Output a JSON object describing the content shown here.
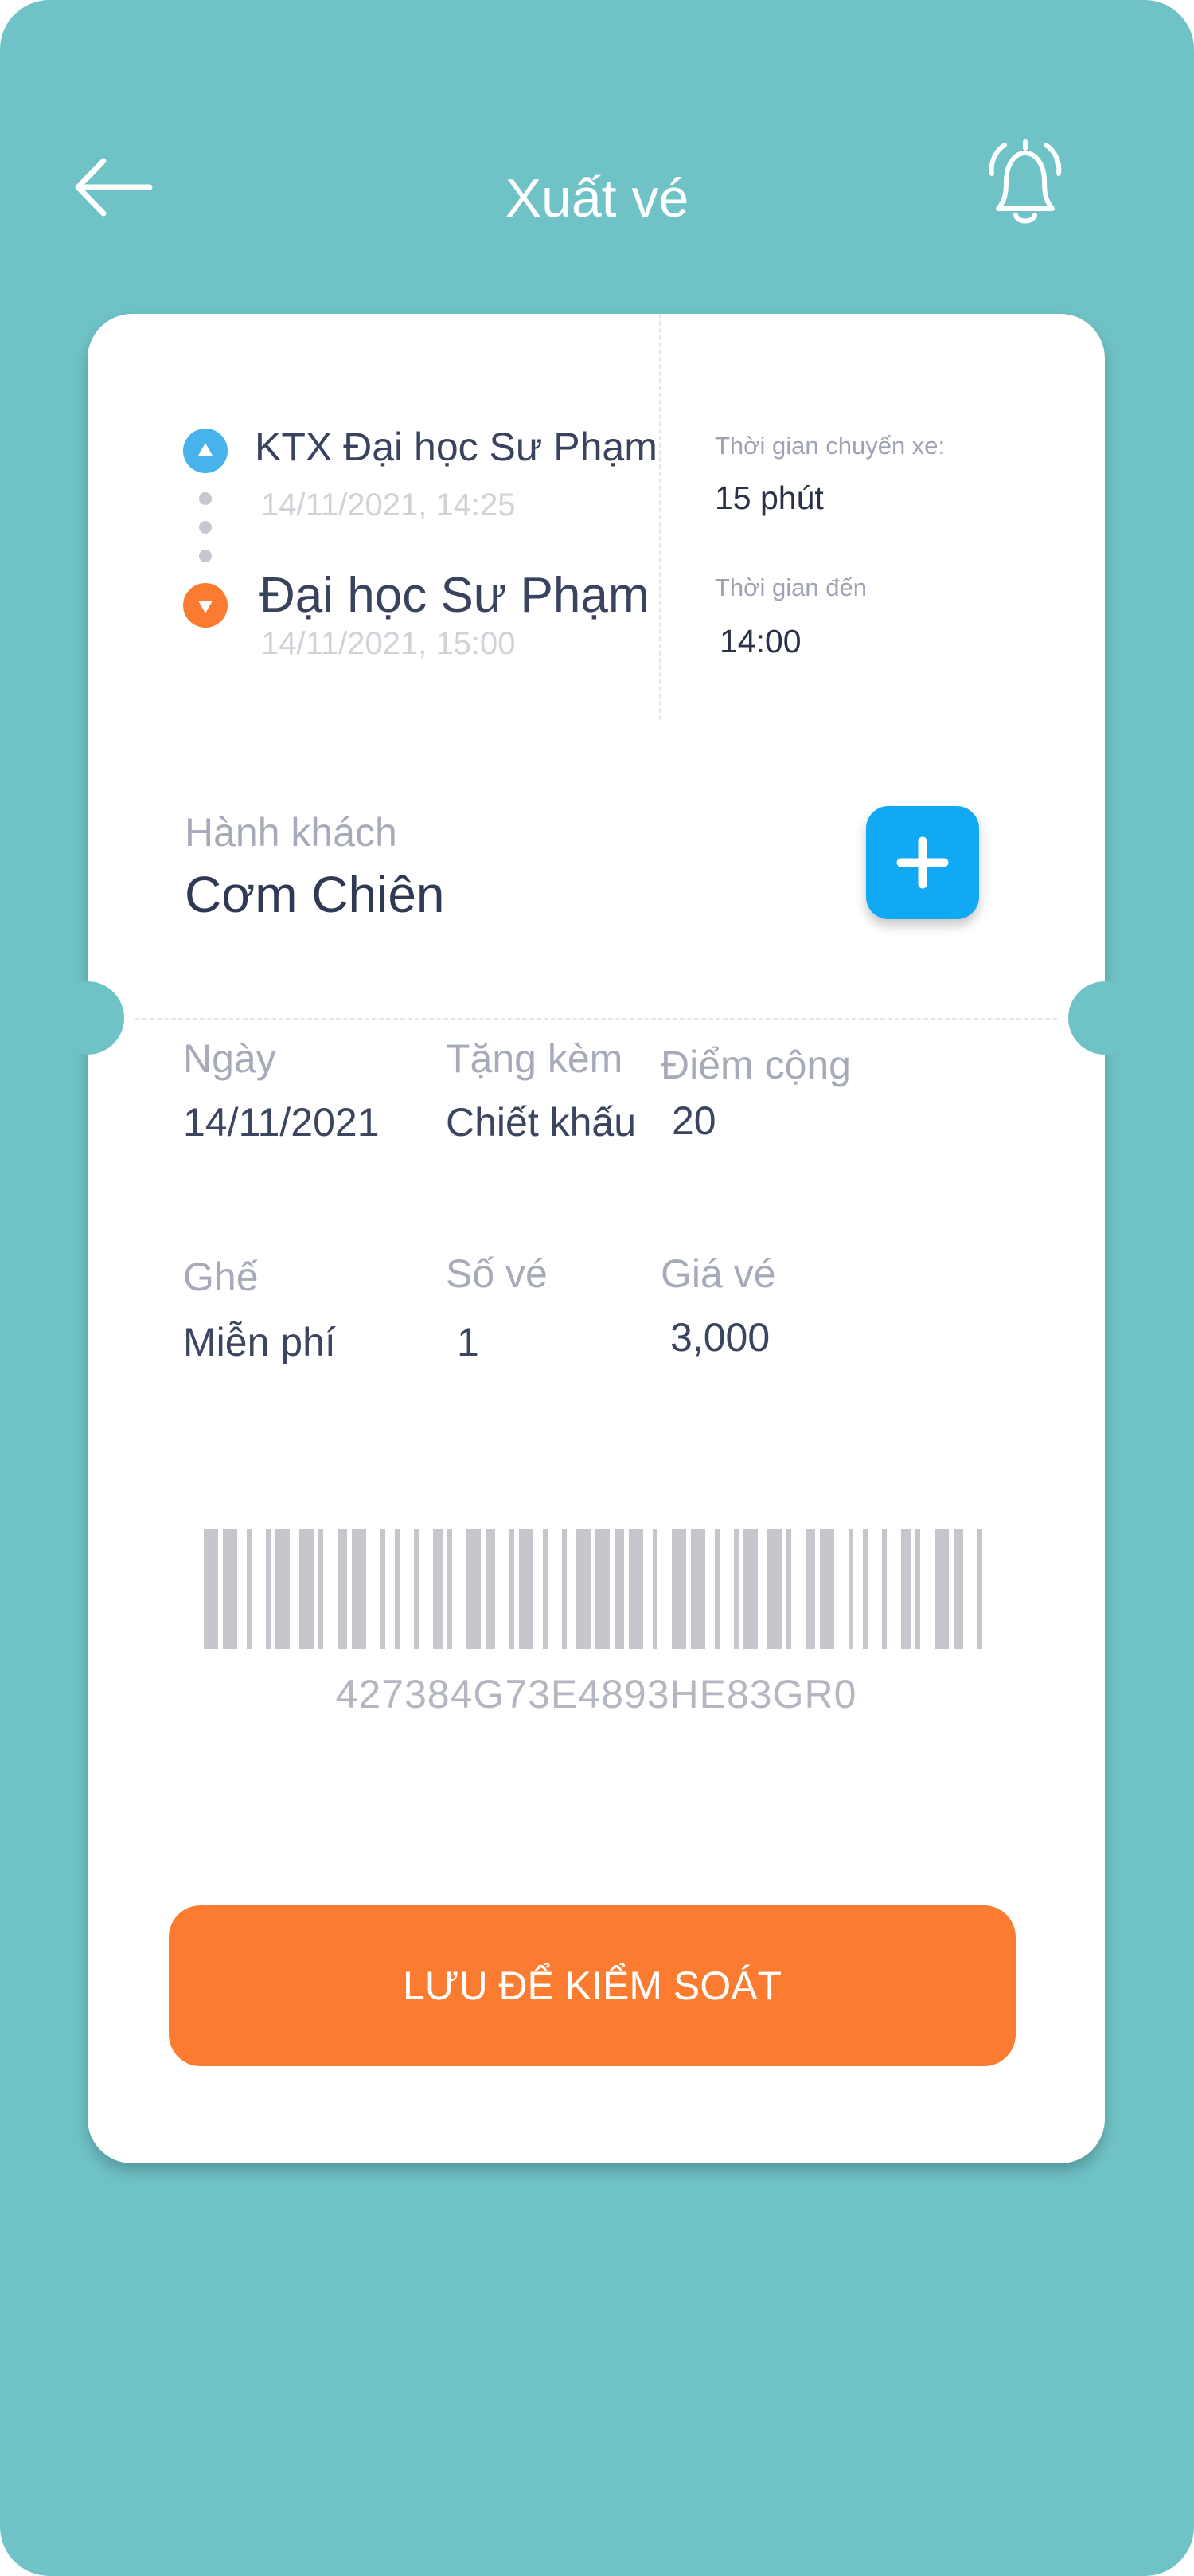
{
  "header": {
    "title": "Xuất vé",
    "back_icon": "arrow-left-icon",
    "bell_icon": "bell-ringing-icon"
  },
  "route": {
    "origin": {
      "name": "KTX Đại học Sư Phạm",
      "time": "14/11/2021, 14:25",
      "marker_color": "#47b3ec"
    },
    "destination": {
      "name": "Đại học Sư Phạm",
      "time": "14/11/2021, 15:00",
      "marker_color": "#fb7c30"
    },
    "transfer_label": "Thời gian chuyến xe:",
    "transfer_value": "15 phút",
    "arrival_label": "Thời gian đến",
    "arrival_value": "14:00"
  },
  "passenger": {
    "label": "Hành khách",
    "name": "Cơm Chiên",
    "add_icon": "plus-icon"
  },
  "details": {
    "date_label": "Ngày",
    "date_value": "14/11/2021",
    "gift_label": "Tặng kèm",
    "gift_value": "Chiết khấu",
    "points_label": "Điểm cộng",
    "points_value": "20",
    "seat_label": "Ghế",
    "seat_value": "Miễn phí",
    "tickets_label": "Số vé",
    "tickets_value": "1",
    "price_label": "Giá vé",
    "price_value": "3,000"
  },
  "barcode": {
    "code": "427384G73E4893HE83GR0"
  },
  "save_button": "LƯU ĐỂ KIỂM SOÁT",
  "colors": {
    "background": "#6fc3c7",
    "accent_blue": "#11a9f3",
    "accent_orange": "#fb7c30",
    "barcode": "#c5c7cd"
  }
}
